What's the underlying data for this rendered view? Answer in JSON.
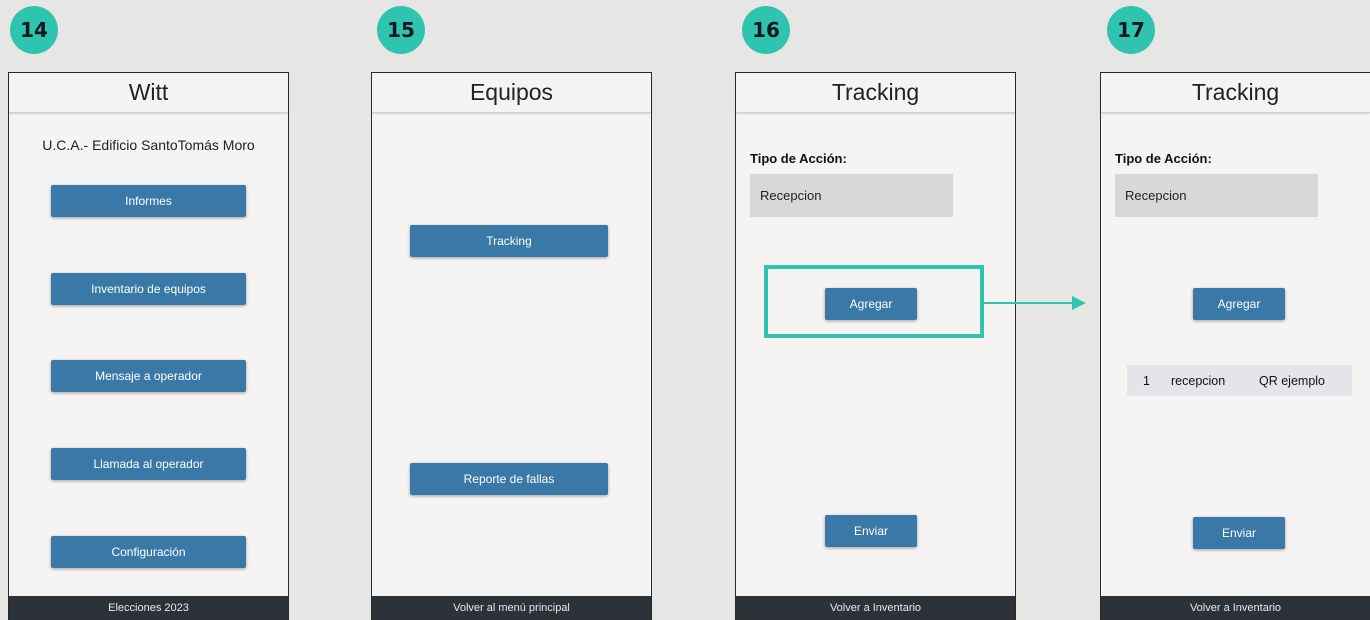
{
  "steps": [
    "14",
    "15",
    "16",
    "17"
  ],
  "screen14": {
    "title": "Witt",
    "subtitle": "U.C.A.- Edificio SantoTomás Moro",
    "buttons": [
      "Informes",
      "Inventario de equipos",
      "Mensaje a operador",
      "Llamada al operador",
      "Configuración"
    ],
    "footer": "Elecciones 2023"
  },
  "screen15": {
    "title": "Equipos",
    "buttons": [
      "Tracking",
      "Reporte de fallas"
    ],
    "footer": "Volver al menú principal"
  },
  "screen16": {
    "title": "Tracking",
    "action_label": "Tipo de Acción:",
    "action_value": "Recepcion",
    "add_button": "Agregar",
    "send_button": "Enviar",
    "footer": "Volver a Inventario"
  },
  "screen17": {
    "title": "Tracking",
    "action_label": "Tipo de Acción:",
    "action_value": "Recepcion",
    "add_button": "Agregar",
    "row": {
      "index": "1",
      "action": "recepcion",
      "code": "QR ejemplo"
    },
    "send_button": "Enviar",
    "footer": "Volver a Inventario"
  },
  "colors": {
    "accent": "#2ec4b0",
    "button": "#3a78a8",
    "footer": "#2d3239",
    "screen_bg": "#f5f4f2",
    "page_bg": "#e6e6e4"
  }
}
